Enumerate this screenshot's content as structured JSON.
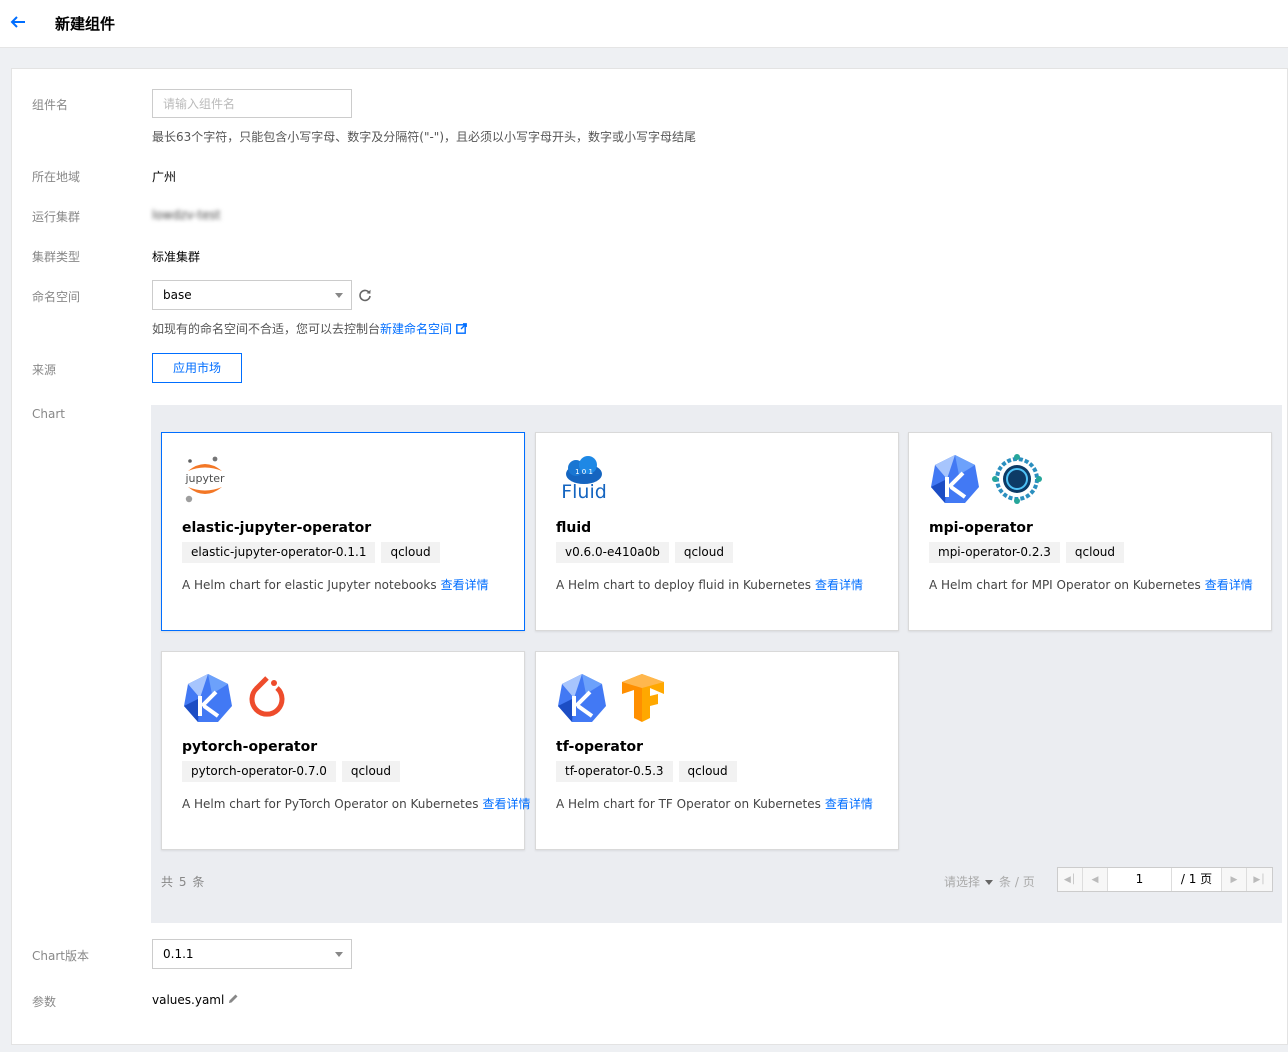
{
  "header": {
    "title": "新建组件"
  },
  "form": {
    "name": {
      "label": "组件名",
      "placeholder": "请输入组件名",
      "hint": "最长63个字符，只能包含小写字母、数字及分隔符(\"-\")，且必须以小写字母开头，数字或小写字母结尾"
    },
    "region": {
      "label": "所在地域",
      "value": "广州"
    },
    "cluster": {
      "label": "运行集群",
      "value": "lowdzv-test"
    },
    "cluster_type": {
      "label": "集群类型",
      "value": "标准集群"
    },
    "namespace": {
      "label": "命名空间",
      "value": "base",
      "hint": "如现有的命名空间不合适，您可以去控制台",
      "link": "新建命名空间"
    },
    "source": {
      "label": "来源",
      "button": "应用市场"
    },
    "chart": {
      "label": "Chart"
    },
    "chart_version": {
      "label": "Chart版本",
      "value": "0.1.1"
    },
    "params": {
      "label": "参数",
      "value": "values.yaml"
    }
  },
  "charts": [
    {
      "name": "elastic-jupyter-operator",
      "version": "elastic-jupyter-operator-0.1.1",
      "repo": "qcloud",
      "desc": "A Helm chart for elastic Jupyter notebooks",
      "detail": "查看详情",
      "logos": [
        "jupyter-logo"
      ],
      "selected": true
    },
    {
      "name": "fluid",
      "version": "v0.6.0-e410a0b",
      "repo": "qcloud",
      "desc": "A Helm chart to deploy fluid in Kubernetes",
      "detail": "查看详情",
      "logos": [
        "fluid-logo"
      ]
    },
    {
      "name": "mpi-operator",
      "version": "mpi-operator-0.2.3",
      "repo": "qcloud",
      "desc": "A Helm chart for MPI Operator on Kubernetes",
      "detail": "查看详情",
      "logos": [
        "kubeflow-logo",
        "horovod-logo"
      ]
    },
    {
      "name": "pytorch-operator",
      "version": "pytorch-operator-0.7.0",
      "repo": "qcloud",
      "desc": "A Helm chart for PyTorch Operator on Kubernetes",
      "detail": "查看详情",
      "logos": [
        "kubeflow-logo",
        "pytorch-logo"
      ]
    },
    {
      "name": "tf-operator",
      "version": "tf-operator-0.5.3",
      "repo": "qcloud",
      "desc": "A Helm chart for TF Operator on Kubernetes",
      "detail": "查看详情",
      "logos": [
        "kubeflow-logo",
        "tensorflow-logo"
      ]
    }
  ],
  "pagination": {
    "total_prefix": "共",
    "total": "5",
    "total_suffix": "条",
    "page_size_placeholder": "请选择",
    "page_size_unit": "条 / 页",
    "current_page": "1",
    "total_pages": "/ 1 页"
  },
  "colors": {
    "accent": "#006eff",
    "label": "#888888",
    "panel_bg": "#ebedf1"
  }
}
